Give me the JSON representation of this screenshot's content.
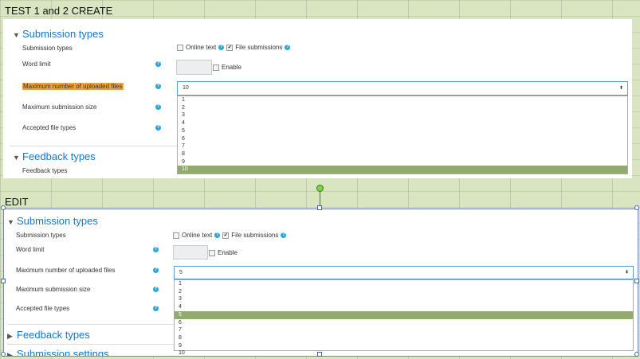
{
  "sections": {
    "create_title": "TEST 1 and 2 CREATE",
    "edit_title": "EDIT"
  },
  "form": {
    "submission_types_heading": "Submission types",
    "feedback_types_heading": "Feedback types",
    "submission_settings_heading": "Submission settings",
    "submission_types_label": "Submission types",
    "online_text": "Online text",
    "file_submissions": "File submissions",
    "word_limit": "Word limit",
    "enable": "Enable",
    "max_files": "Maximum number of uploaded files",
    "max_size": "Maximum submission size",
    "accepted_types": "Accepted file types",
    "feedback_types_label": "Feedback types",
    "help_glyph": "?",
    "check_glyph": "✔",
    "caret_down": "▼",
    "caret_right": "▶",
    "select_arrow": "⬍"
  },
  "create": {
    "selected_value": "10",
    "options": [
      "1",
      "2",
      "3",
      "4",
      "5",
      "6",
      "7",
      "8",
      "9",
      "10"
    ],
    "highlight_color": "#f0a33a"
  },
  "edit": {
    "selected_value": "5",
    "options": [
      "1",
      "2",
      "3",
      "4",
      "5",
      "6",
      "7",
      "8",
      "9",
      "10"
    ]
  },
  "colors": {
    "heading": "#1177d1",
    "selected_option": "#92aa6b",
    "help_icon": "#2aa7d6"
  }
}
